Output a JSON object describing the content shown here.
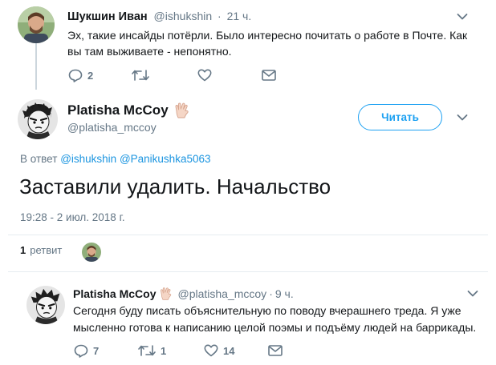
{
  "tweet1": {
    "author_name": "Шукшин Иван",
    "author_handle": "@ishukshin",
    "separator": "·",
    "time": "21 ч.",
    "text": "Эх, такие инсайды потёрли. Было интересно почитать о работе в Почте. Как вы там выживаете - непонятно.",
    "reply_count": "2",
    "retweet_count": "",
    "like_count": ""
  },
  "main_tweet": {
    "author_name": "Platisha McCoy",
    "author_handle": "@platisha_mccoy",
    "badge_icon": "vulcan-salute-emoji",
    "follow_label": "Читать",
    "reply_to_prefix": "В ответ",
    "reply_to_users": [
      "@ishukshin",
      "@Panikushka5063"
    ],
    "text": "Заставили удалить. Начальство",
    "timestamp": "19:28 - 2 июл. 2018 г.",
    "retweet_count": "1",
    "retweet_label": "ретвит"
  },
  "tweet3": {
    "author_name": "Platisha McCoy",
    "author_handle": "@platisha_mccoy",
    "separator": "·",
    "time": "9 ч.",
    "text": "Сегодня буду писать объяснительную по поводу вчерашнего треда. Я уже мысленно готова к написанию целой поэмы и подъёму людей на баррикады.",
    "reply_count": "7",
    "retweet_count": "1",
    "like_count": "14"
  },
  "colors": {
    "accent": "#1da1f2",
    "link": "#1b95e0",
    "muted": "#657786",
    "text": "#14171a",
    "divider": "#e6ecf0"
  }
}
